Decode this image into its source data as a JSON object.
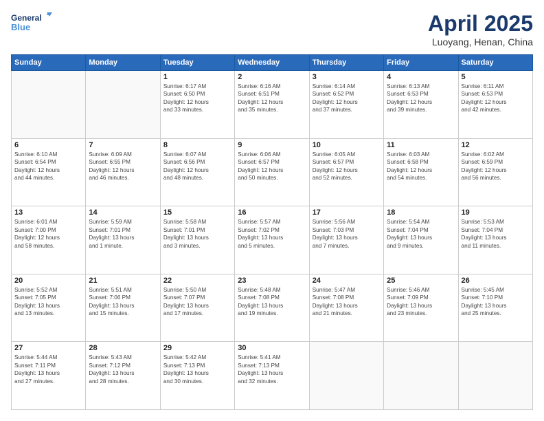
{
  "logo": {
    "line1": "General",
    "line2": "Blue"
  },
  "title": "April 2025",
  "location": "Luoyang, Henan, China",
  "weekdays": [
    "Sunday",
    "Monday",
    "Tuesday",
    "Wednesday",
    "Thursday",
    "Friday",
    "Saturday"
  ],
  "weeks": [
    [
      {
        "day": "",
        "info": ""
      },
      {
        "day": "",
        "info": ""
      },
      {
        "day": "1",
        "info": "Sunrise: 6:17 AM\nSunset: 6:50 PM\nDaylight: 12 hours\nand 33 minutes."
      },
      {
        "day": "2",
        "info": "Sunrise: 6:16 AM\nSunset: 6:51 PM\nDaylight: 12 hours\nand 35 minutes."
      },
      {
        "day": "3",
        "info": "Sunrise: 6:14 AM\nSunset: 6:52 PM\nDaylight: 12 hours\nand 37 minutes."
      },
      {
        "day": "4",
        "info": "Sunrise: 6:13 AM\nSunset: 6:53 PM\nDaylight: 12 hours\nand 39 minutes."
      },
      {
        "day": "5",
        "info": "Sunrise: 6:11 AM\nSunset: 6:53 PM\nDaylight: 12 hours\nand 42 minutes."
      }
    ],
    [
      {
        "day": "6",
        "info": "Sunrise: 6:10 AM\nSunset: 6:54 PM\nDaylight: 12 hours\nand 44 minutes."
      },
      {
        "day": "7",
        "info": "Sunrise: 6:09 AM\nSunset: 6:55 PM\nDaylight: 12 hours\nand 46 minutes."
      },
      {
        "day": "8",
        "info": "Sunrise: 6:07 AM\nSunset: 6:56 PM\nDaylight: 12 hours\nand 48 minutes."
      },
      {
        "day": "9",
        "info": "Sunrise: 6:06 AM\nSunset: 6:57 PM\nDaylight: 12 hours\nand 50 minutes."
      },
      {
        "day": "10",
        "info": "Sunrise: 6:05 AM\nSunset: 6:57 PM\nDaylight: 12 hours\nand 52 minutes."
      },
      {
        "day": "11",
        "info": "Sunrise: 6:03 AM\nSunset: 6:58 PM\nDaylight: 12 hours\nand 54 minutes."
      },
      {
        "day": "12",
        "info": "Sunrise: 6:02 AM\nSunset: 6:59 PM\nDaylight: 12 hours\nand 56 minutes."
      }
    ],
    [
      {
        "day": "13",
        "info": "Sunrise: 6:01 AM\nSunset: 7:00 PM\nDaylight: 12 hours\nand 58 minutes."
      },
      {
        "day": "14",
        "info": "Sunrise: 5:59 AM\nSunset: 7:01 PM\nDaylight: 13 hours\nand 1 minute."
      },
      {
        "day": "15",
        "info": "Sunrise: 5:58 AM\nSunset: 7:01 PM\nDaylight: 13 hours\nand 3 minutes."
      },
      {
        "day": "16",
        "info": "Sunrise: 5:57 AM\nSunset: 7:02 PM\nDaylight: 13 hours\nand 5 minutes."
      },
      {
        "day": "17",
        "info": "Sunrise: 5:56 AM\nSunset: 7:03 PM\nDaylight: 13 hours\nand 7 minutes."
      },
      {
        "day": "18",
        "info": "Sunrise: 5:54 AM\nSunset: 7:04 PM\nDaylight: 13 hours\nand 9 minutes."
      },
      {
        "day": "19",
        "info": "Sunrise: 5:53 AM\nSunset: 7:04 PM\nDaylight: 13 hours\nand 11 minutes."
      }
    ],
    [
      {
        "day": "20",
        "info": "Sunrise: 5:52 AM\nSunset: 7:05 PM\nDaylight: 13 hours\nand 13 minutes."
      },
      {
        "day": "21",
        "info": "Sunrise: 5:51 AM\nSunset: 7:06 PM\nDaylight: 13 hours\nand 15 minutes."
      },
      {
        "day": "22",
        "info": "Sunrise: 5:50 AM\nSunset: 7:07 PM\nDaylight: 13 hours\nand 17 minutes."
      },
      {
        "day": "23",
        "info": "Sunrise: 5:48 AM\nSunset: 7:08 PM\nDaylight: 13 hours\nand 19 minutes."
      },
      {
        "day": "24",
        "info": "Sunrise: 5:47 AM\nSunset: 7:08 PM\nDaylight: 13 hours\nand 21 minutes."
      },
      {
        "day": "25",
        "info": "Sunrise: 5:46 AM\nSunset: 7:09 PM\nDaylight: 13 hours\nand 23 minutes."
      },
      {
        "day": "26",
        "info": "Sunrise: 5:45 AM\nSunset: 7:10 PM\nDaylight: 13 hours\nand 25 minutes."
      }
    ],
    [
      {
        "day": "27",
        "info": "Sunrise: 5:44 AM\nSunset: 7:11 PM\nDaylight: 13 hours\nand 27 minutes."
      },
      {
        "day": "28",
        "info": "Sunrise: 5:43 AM\nSunset: 7:12 PM\nDaylight: 13 hours\nand 28 minutes."
      },
      {
        "day": "29",
        "info": "Sunrise: 5:42 AM\nSunset: 7:13 PM\nDaylight: 13 hours\nand 30 minutes."
      },
      {
        "day": "30",
        "info": "Sunrise: 5:41 AM\nSunset: 7:13 PM\nDaylight: 13 hours\nand 32 minutes."
      },
      {
        "day": "",
        "info": ""
      },
      {
        "day": "",
        "info": ""
      },
      {
        "day": "",
        "info": ""
      }
    ]
  ]
}
